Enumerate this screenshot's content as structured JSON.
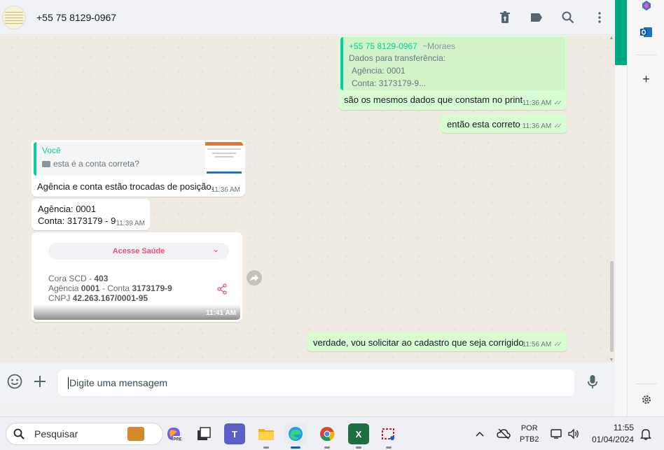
{
  "header": {
    "contact": "+55 75 8129-0967",
    "icons": [
      "delete-icon",
      "label-icon",
      "search-icon",
      "menu-icon"
    ]
  },
  "messages": {
    "m1": {
      "quote_author": "+55 75 8129-0967",
      "quote_author_alias": "~Moraes",
      "quote_lines": [
        "Dados para transferência:",
        "Agência: 0001",
        "Conta: 3173179-9..."
      ],
      "text": "são os mesmos dados que constam no print",
      "time": "11:36 AM"
    },
    "m2": {
      "text": "então esta correto",
      "time": "11:36 AM"
    },
    "m3": {
      "quote_author": "Você",
      "quote_text": "esta é a conta correta?",
      "text": "Agência e conta estão trocadas de posição.",
      "time": "11:36 AM"
    },
    "m4": {
      "line1": "Agência: 0001",
      "line2": "Conta: 3173179 - 9",
      "time": "11:39 AM"
    },
    "m5": {
      "card_title": "Acesse Saúde",
      "bank_label": "Cora SCD - ",
      "bank_code": "403",
      "agency_label": "Agência ",
      "agency_value": "0001",
      "account_label": " - Conta ",
      "account_value": "3173179-9",
      "cnpj_label": "CNPJ ",
      "cnpj_value": "42.263.167/0001-95",
      "time": "11:41 AM"
    },
    "m6": {
      "text": "verdade, vou solicitar ao cadastro que seja corrigido",
      "time": "11:56 AM"
    }
  },
  "composer": {
    "placeholder": "Digite uma mensagem"
  },
  "taskbar": {
    "search_label": "Pesquisar",
    "lang": "POR",
    "layout": "PTB2",
    "time": "11:55",
    "date": "01/04/2024"
  },
  "colors": {
    "accent": "#00a884",
    "outgoing_bubble": "#d9fdd3",
    "quote_author": "#06cf9c",
    "card_title": "#e8507a"
  }
}
